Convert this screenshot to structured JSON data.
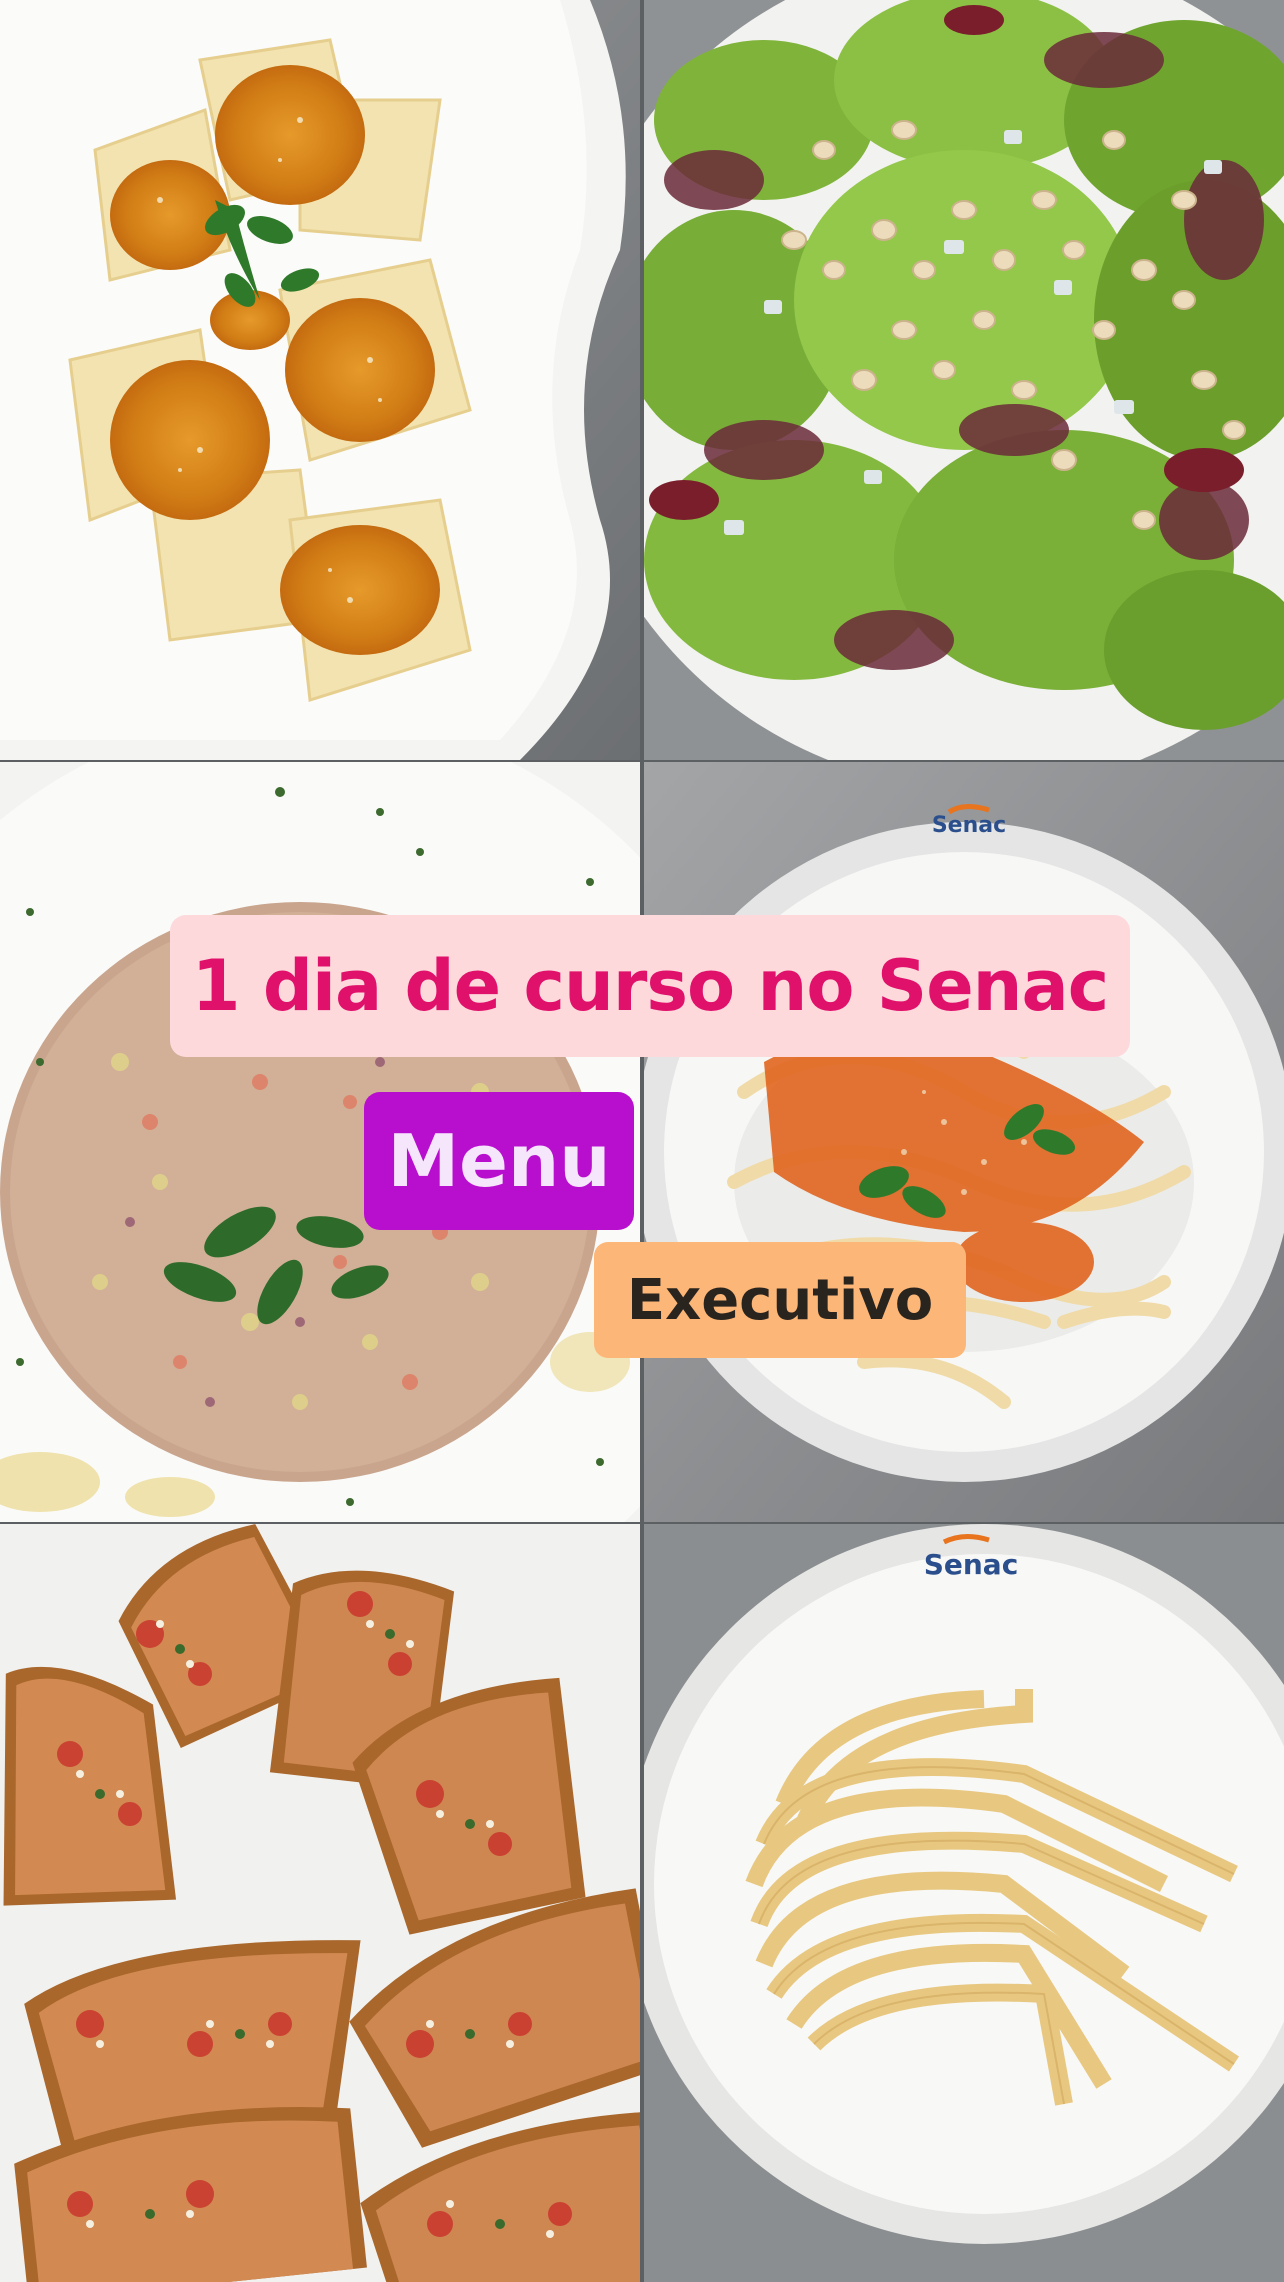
{
  "overlay": {
    "title": "1 dia de curso no Senac",
    "menu": "Menu",
    "executivo": "Executivo"
  },
  "plate_logos": {
    "plate_fettuccine_sauce": "Senac",
    "plate_fresh_pasta": "Senac"
  },
  "colors": {
    "title_bg": "#fdd9dc",
    "title_text": "#e0116b",
    "menu_bg": "#b80fcf",
    "menu_text": "#f6e6fb",
    "executivo_bg": "#fbb678",
    "executivo_text": "#2a241f"
  }
}
